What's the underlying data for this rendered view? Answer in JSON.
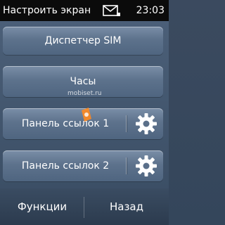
{
  "status_bar": {
    "title": "Настроить экран",
    "icon": "message-icon",
    "time": "23:03"
  },
  "list": {
    "items": [
      {
        "label": "Диспетчер SIM",
        "has_settings": false
      },
      {
        "label": "Часы",
        "has_settings": false
      },
      {
        "label": "Панель ссылок 1",
        "has_settings": true,
        "settings_icon": "gear-icon"
      },
      {
        "label": "Панель ссылок 2",
        "has_settings": true,
        "settings_icon": "gear-icon"
      }
    ]
  },
  "watermark": {
    "text": "mobiset.ru"
  },
  "softkeys": {
    "left": "Функции",
    "right": "Назад"
  },
  "colors": {
    "status_bar_bg": "#0b0b0b",
    "item_bg": "#5d728c",
    "background": "#3c4f66",
    "text": "#ffffff"
  }
}
